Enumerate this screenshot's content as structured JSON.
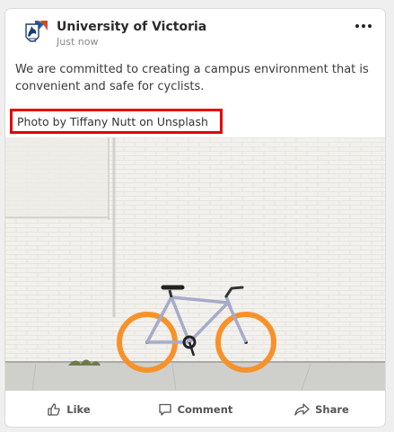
{
  "post": {
    "author": "University of Victoria",
    "timestamp": "Just now",
    "text": "We are committed to creating a campus environment that is convenient and safe for cyclists.",
    "photo_credit": "Photo by Tiffany Nutt on Unsplash"
  },
  "actions": {
    "like": "Like",
    "comment": "Comment",
    "share": "Share"
  },
  "icons": {
    "logo": "university-crest-icon",
    "menu": "more-horizontal-icon",
    "like": "thumbs-up-icon",
    "comment": "speech-bubble-icon",
    "share": "share-arrow-icon"
  },
  "colors": {
    "highlight": "#e60000",
    "bike_wheels": "#f7922b",
    "bike_frame": "#a7aac9"
  }
}
